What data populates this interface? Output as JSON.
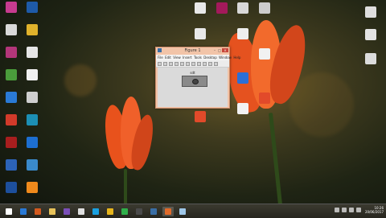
{
  "desktop": {
    "icons_left": [
      {
        "label": "",
        "color": "#c73b8f",
        "icon": "app-icon"
      },
      {
        "label": "",
        "color": "#1e5aa8",
        "icon": "app-icon"
      },
      {
        "label": "",
        "color": "#d9d9d9",
        "icon": "file-icon"
      },
      {
        "label": "",
        "color": "#e0b22b",
        "icon": "app-icon"
      },
      {
        "label": "",
        "color": "#b3367a",
        "icon": "app-icon"
      },
      {
        "label": "",
        "color": "#e6e6e6",
        "icon": "file-icon"
      },
      {
        "label": "",
        "color": "#4a9c3b",
        "icon": "app-icon"
      },
      {
        "label": "",
        "color": "#f0f0f0",
        "icon": "file-icon"
      },
      {
        "label": "",
        "color": "#2a7ad6",
        "icon": "browser-icon"
      },
      {
        "label": "",
        "color": "#cfcfcf",
        "icon": "recycle-bin-icon"
      },
      {
        "label": "",
        "color": "#d23a2a",
        "icon": "app-icon"
      },
      {
        "label": "",
        "color": "#1c8fb5",
        "icon": "app-icon"
      },
      {
        "label": "",
        "color": "#a81e1e",
        "icon": "pdf-icon"
      },
      {
        "label": "",
        "color": "#1d6fd1",
        "icon": "app-icon"
      },
      {
        "label": "",
        "color": "#2c63b8",
        "icon": "app-icon"
      },
      {
        "label": "",
        "color": "#3a8acb",
        "icon": "app-icon"
      },
      {
        "label": "",
        "color": "#1d4f9c",
        "icon": "app-icon"
      },
      {
        "label": "",
        "color": "#f08a1c",
        "icon": "vlc-icon"
      }
    ],
    "icons_top": [
      {
        "label": "",
        "color": "#e8e8e8",
        "icon": "file-icon"
      },
      {
        "label": "",
        "color": "#a3195b",
        "icon": "app-icon"
      },
      {
        "label": "",
        "color": "#d8d8d8",
        "icon": "file-icon"
      },
      {
        "label": "",
        "color": "#cccccc",
        "icon": "file-icon"
      }
    ],
    "icons_right_col1": [
      {
        "label": "",
        "color": "#e9e9e9",
        "icon": "file-icon"
      },
      {
        "label": "",
        "color": "#f0f0f0",
        "icon": "file-icon"
      },
      {
        "label": "",
        "color": "#2c6fd6",
        "icon": "word-icon"
      },
      {
        "label": "",
        "color": "#f2f2f2",
        "icon": "file-icon"
      },
      {
        "label": "",
        "color": "#e24a2a",
        "icon": "pdf-icon"
      }
    ],
    "icons_right_col2": [
      {
        "label": "",
        "color": "#eeeeee",
        "icon": "file-icon"
      },
      {
        "label": "",
        "color": "#f1f1f1",
        "icon": "file-icon"
      },
      {
        "label": "",
        "color": "#2c6fd6",
        "icon": "word-icon"
      },
      {
        "label": "",
        "color": "#e24a2a",
        "icon": "pdf-icon"
      },
      {
        "label": "",
        "color": "#f2f2f2",
        "icon": "file-icon"
      }
    ],
    "icons_far_right": [
      {
        "label": "",
        "color": "#dedede",
        "icon": "file-icon"
      },
      {
        "label": "",
        "color": "#e3e3e3",
        "icon": "file-icon"
      },
      {
        "label": "",
        "color": "#dcdcdc",
        "icon": "file-icon"
      }
    ]
  },
  "window": {
    "title": "Figure 1",
    "menu": [
      "File",
      "Edit",
      "View",
      "Insert",
      "Tools",
      "Desktop",
      "Window",
      "Help"
    ],
    "axes_title": "sdt",
    "titlebar_color": "#f2c4a8"
  },
  "taskbar": {
    "clock_time": "10:26",
    "clock_date": "20/06/2017",
    "items": [
      {
        "icon": "start-icon",
        "color": "#ffffff"
      },
      {
        "icon": "ie-icon",
        "color": "#2a7ad6"
      },
      {
        "icon": "matlab-icon",
        "color": "#d35a1f"
      },
      {
        "icon": "folder-icon",
        "color": "#e8c35a"
      },
      {
        "icon": "visual-studio-icon",
        "color": "#7b4fb8"
      },
      {
        "icon": "media-icon",
        "color": "#e0e0e0"
      },
      {
        "icon": "skype-icon",
        "color": "#1aa0e0"
      },
      {
        "icon": "chrome-icon",
        "color": "#e8b61c"
      },
      {
        "icon": "app-green-icon",
        "color": "#2faf4a"
      },
      {
        "icon": "calculator-icon",
        "color": "#4a4a4a"
      },
      {
        "icon": "settings-icon",
        "color": "#3a6ea5"
      },
      {
        "icon": "figure-icon",
        "color": "#e06a2a"
      },
      {
        "icon": "notepad-icon",
        "color": "#9fc7e8"
      }
    ]
  }
}
